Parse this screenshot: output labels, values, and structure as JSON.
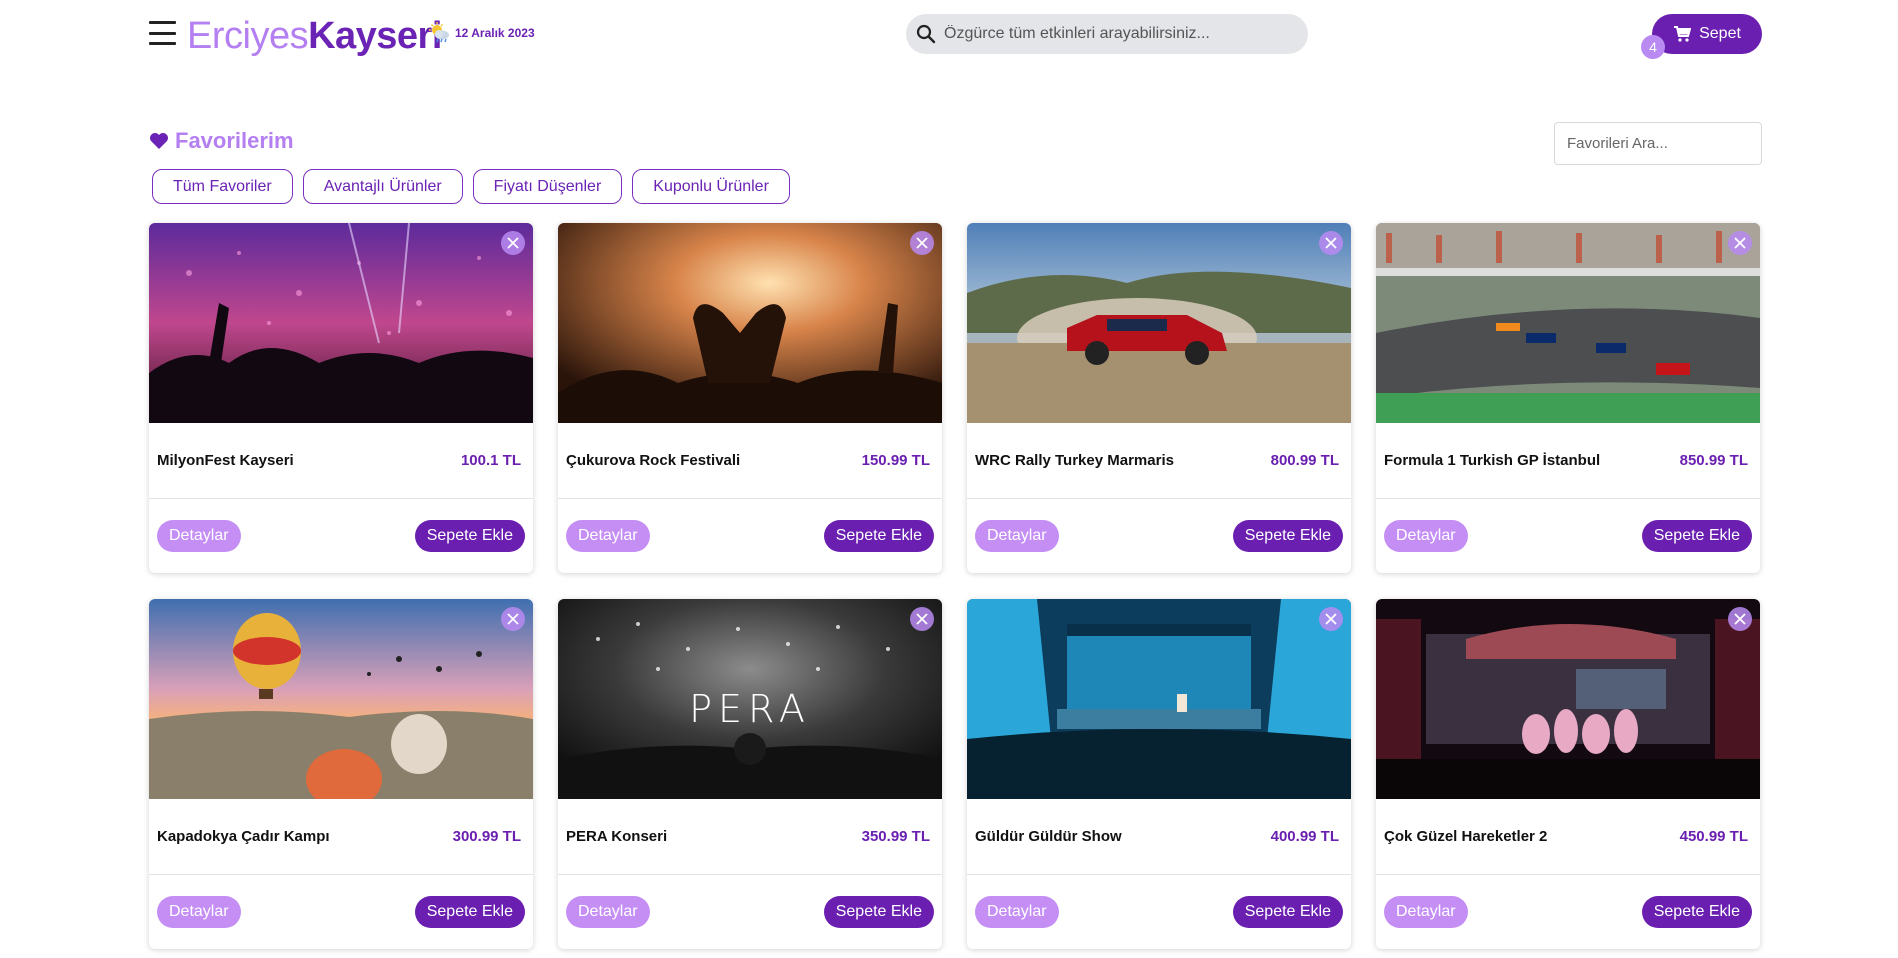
{
  "header": {
    "logo_light": "Erciyes",
    "logo_bold": "Kayseri",
    "date": "12 Aralık 2023",
    "search_placeholder": "Özgürce tüm etkinleri arayabilirsiniz...",
    "cart_label": "Sepet",
    "cart_count": "4"
  },
  "favorites": {
    "title": "Favorilerim",
    "search_placeholder": "Favorileri Ara...",
    "filters": [
      "Tüm Favoriler",
      "Avantajlı Ürünler",
      "Fiyatı Düşenler",
      "Kuponlu Ürünler"
    ]
  },
  "card_buttons": {
    "detail": "Detaylar",
    "add": "Sepete Ekle"
  },
  "cards": [
    {
      "name": "MilyonFest Kayseri",
      "price": "100.1 TL",
      "image": "concert-pink-crowd"
    },
    {
      "name": "Çukurova Rock Festivali",
      "price": "150.99 TL",
      "image": "concert-heart-hands"
    },
    {
      "name": "WRC Rally Turkey Marmaris",
      "price": "800.99 TL",
      "image": "rally-car-dust"
    },
    {
      "name": "Formula 1 Turkish GP İstanbul",
      "price": "850.99 TL",
      "image": "f1-race-track"
    },
    {
      "name": "Kapadokya Çadır Kampı",
      "price": "300.99 TL",
      "image": "hot-air-balloons"
    },
    {
      "name": "PERA Konseri",
      "price": "350.99 TL",
      "image": "pera-concert-bw",
      "image_text": "PERA"
    },
    {
      "name": "Güldür Güldür Show",
      "price": "400.99 TL",
      "image": "theater-blue-stage"
    },
    {
      "name": "Çok Güzel Hareketler 2",
      "price": "450.99 TL",
      "image": "theater-dark-stage"
    }
  ],
  "colors": {
    "brand": "#6a1fb0",
    "accent_light": "#b47ff0",
    "detail_button": "#c58ef5"
  }
}
